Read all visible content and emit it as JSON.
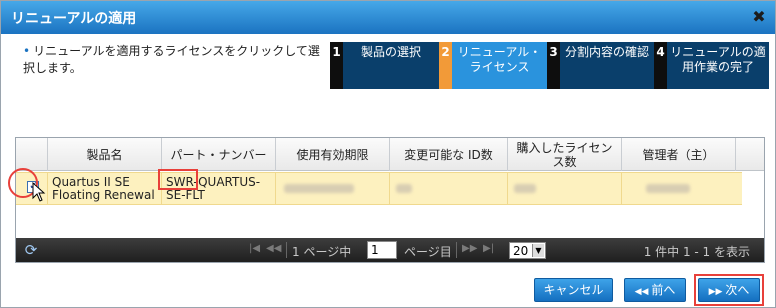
{
  "dialog": {
    "title": "リニューアルの適用",
    "close_glyph": "✖"
  },
  "instructions": "リニューアルを適用するライセンスをクリックして選択します。",
  "steps": [
    {
      "num": "1",
      "label": "製品の選択"
    },
    {
      "num": "2",
      "label": "リニューアル・ライセンス"
    },
    {
      "num": "3",
      "label": "分割内容の確認"
    },
    {
      "num": "4",
      "label": "リニューアルの適用作業の完了"
    }
  ],
  "active_step": 2,
  "grid": {
    "columns": [
      "製品名",
      "パート・ナンバー",
      "使用有効期限",
      "変更可能な ID数",
      "購入したライセンス数",
      "管理者（主）"
    ],
    "rows": [
      {
        "checked": true,
        "product": "Quartus II SE Floating Renewal",
        "part_number": "SWR-QUARTUS-SE-FLT"
      }
    ]
  },
  "pager": {
    "page_prefix": "1 ページ中",
    "page_value": "1",
    "page_suffix": "ページ目",
    "page_size": "20",
    "count_text": "1 件中 1 - 1 を表示"
  },
  "buttons": {
    "cancel": "キャンセル",
    "prev": "前へ",
    "next": "次へ"
  },
  "colors": {
    "title_bar": "#1b73c1",
    "step_active": "#2a93dd",
    "step_inactive": "#0a3f6b",
    "active_step_number": "#f29a38",
    "selected_row": "#fdf1bf",
    "highlight": "#e8403a"
  },
  "icons": {
    "close": "close-icon",
    "refresh": "refresh-icon",
    "first": "first-page-icon",
    "prev_page": "prev-page-icon",
    "next_page": "next-page-icon",
    "last": "last-page-icon",
    "dropdown": "chevron-down-icon",
    "cursor": "mouse-cursor-icon"
  }
}
